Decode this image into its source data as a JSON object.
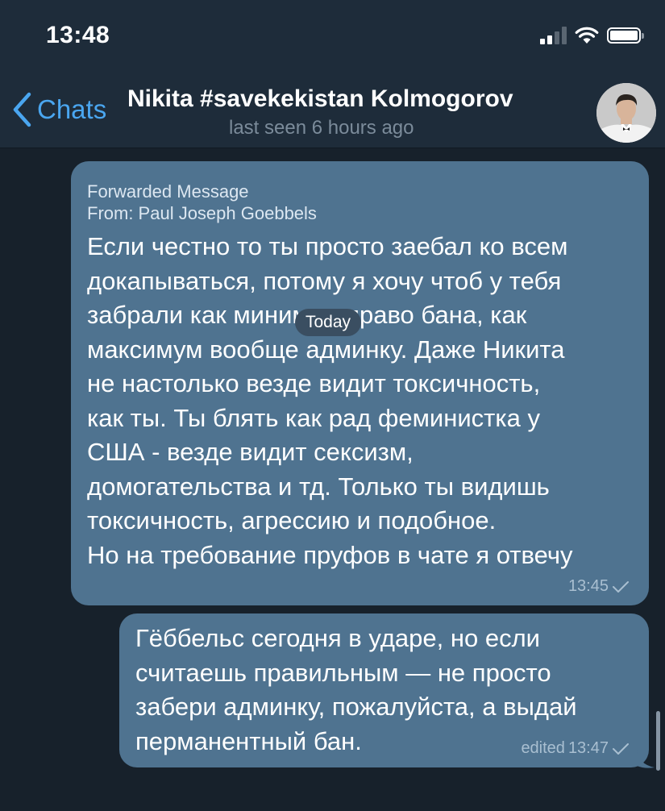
{
  "status_bar": {
    "time": "13:48",
    "icons": [
      "signal-icon",
      "wifi-icon",
      "battery-icon"
    ]
  },
  "header": {
    "back_label": "Chats",
    "title": "Nikita #savekekistan Kolmogorov",
    "subtitle": "last seen 6 hours ago"
  },
  "date_separator": "Today",
  "messages": [
    {
      "forwarded_label": "Forwarded Message",
      "forwarded_from": "From: Paul Joseph Goebbels",
      "text": "Если честно то ты просто заебал ко всем\nдокапываться, потому я хочу чтоб у тебя\nзабрали как минимум право бана, как\nмаксимум вообще админку. Даже Никита\nне настолько везде видит токсичность,\nкак ты. Ты блять как рад феминистка у\nСША - везде видит сексизм,\nдомогательства и тд. Только ты видишь\nтоксичность, агрессию и подобное.\nНо на требование пруфов в чате я отвечу",
      "time": "13:45",
      "status_icon": "check-icon"
    },
    {
      "text": "Гёббельс сегодня в ударе, но если\nсчитаешь правильным — не просто\nзабери админку, пожалуйста, а выдай\nперманентный бан.",
      "edited_label": "edited",
      "time": "13:47",
      "status_icon": "check-icon"
    }
  ],
  "colors": {
    "background": "#17212b",
    "header": "#1e2c3a",
    "bubble": "#4f7390",
    "accent": "#4aa6f0",
    "subtitle": "#7b8b9a",
    "meta": "#a9bfd1"
  }
}
